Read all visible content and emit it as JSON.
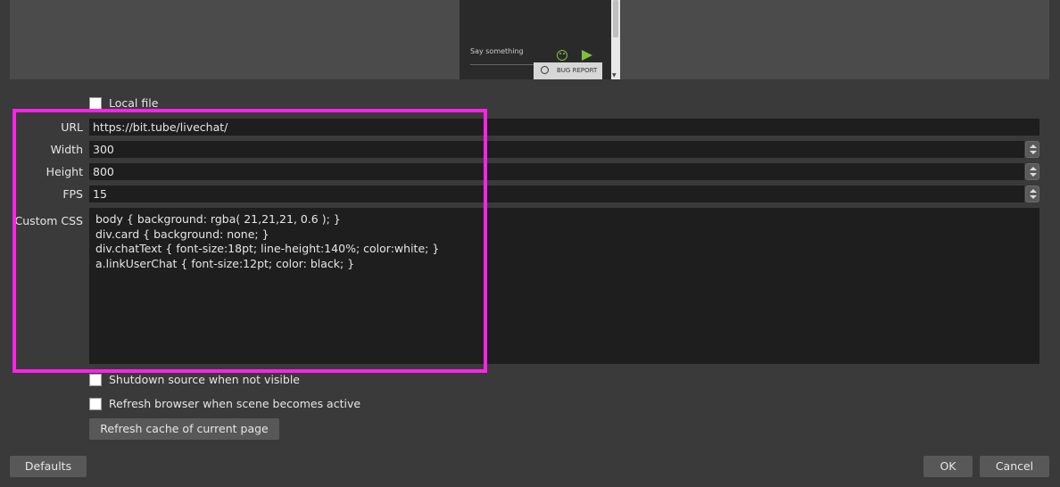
{
  "preview": {
    "chat_placeholder": "Say something",
    "bug_report_label": "BUG REPORT",
    "emoji_icon": "smiley-icon",
    "send_icon": "send-arrow-icon"
  },
  "local_file": {
    "label": "Local file",
    "checked": false
  },
  "url": {
    "label": "URL",
    "value": "https://bit.tube/livechat/"
  },
  "width": {
    "label": "Width",
    "value": "300"
  },
  "height": {
    "label": "Height",
    "value": "800"
  },
  "fps": {
    "label": "FPS",
    "value": "15"
  },
  "custom_css": {
    "label": "Custom CSS",
    "lines": [
      "body { background: rgba( 21,21,21, 0.6 ); }",
      "div.card { background: none; }",
      "div.chatText { font-size:18pt; line-height:140%; color:white; }",
      "a.linkUserChat { font-size:12pt; color: black; }"
    ]
  },
  "shutdown_source": {
    "label": "Shutdown source when not visible",
    "checked": false
  },
  "refresh_browser": {
    "label": "Refresh browser when scene becomes active",
    "checked": false
  },
  "refresh_cache_button": "Refresh cache of current page",
  "footer": {
    "defaults": "Defaults",
    "ok": "OK",
    "cancel": "Cancel"
  },
  "colors": {
    "highlight": "#ff22e8",
    "background": "#3a3a3a",
    "input_bg": "#1e1e1e",
    "accent_green": "#7fbf3f"
  }
}
